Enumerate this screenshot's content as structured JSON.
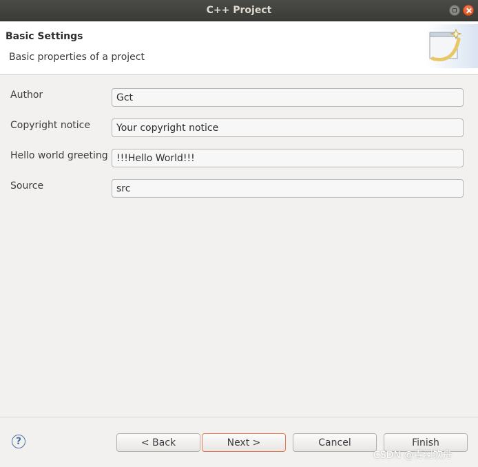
{
  "window": {
    "title": "C++ Project"
  },
  "header": {
    "title": "Basic Settings",
    "description": "Basic properties of a project"
  },
  "fields": [
    {
      "label": "Author",
      "value": "Gct"
    },
    {
      "label": "Copyright notice",
      "value": "Your copyright notice"
    },
    {
      "label": "Hello world greeting",
      "value": "!!!Hello World!!!"
    },
    {
      "label": "Source",
      "value": "src"
    }
  ],
  "footer": {
    "help_glyph": "?",
    "back_label": "< Back",
    "next_label": "Next >",
    "cancel_label": "Cancel",
    "finish_label": "Finish"
  },
  "watermark": "CSDN @青澜饮舟",
  "colors": {
    "close_button": "#e0531e",
    "focused_button_border": "#e9774d"
  }
}
